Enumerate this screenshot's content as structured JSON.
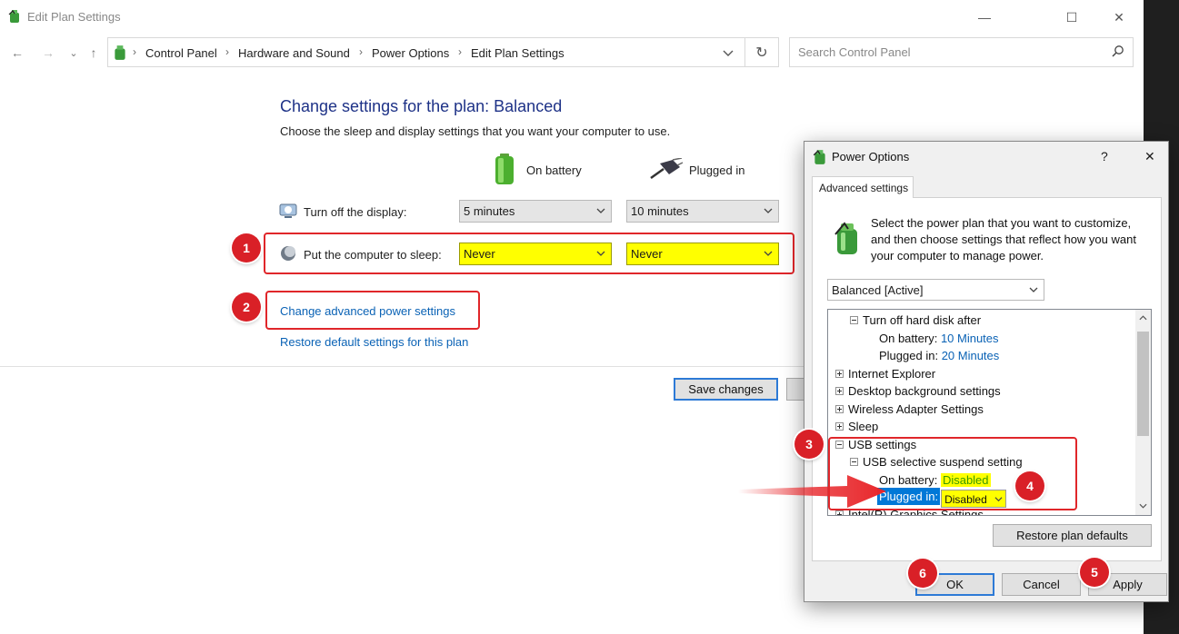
{
  "window": {
    "title": "Edit Plan Settings",
    "controls": {
      "minimize": "—",
      "maximize": "☐",
      "close": "✕"
    }
  },
  "nav": {
    "back": "←",
    "forward": "→",
    "recent": "⌄",
    "up": "↑",
    "breadcrumb": [
      "Control Panel",
      "Hardware and Sound",
      "Power Options",
      "Edit Plan Settings"
    ],
    "refresh": "↻",
    "search_placeholder": "Search Control Panel"
  },
  "plan": {
    "heading": "Change settings for the plan: Balanced",
    "subtitle": "Choose the sleep and display settings that you want your computer to use.",
    "col_battery": "On battery",
    "col_plugged": "Plugged in",
    "rows": [
      {
        "label": "Turn off the display:",
        "battery": "5 minutes",
        "plugged": "10 minutes"
      },
      {
        "label": "Put the computer to sleep:",
        "battery": "Never",
        "plugged": "Never"
      }
    ],
    "advanced_link": "Change advanced power settings",
    "restore_link": "Restore default settings for this plan",
    "save_button": "Save changes"
  },
  "badges": [
    "1",
    "2",
    "3",
    "4",
    "5",
    "6"
  ],
  "dialog": {
    "title": "Power Options",
    "help": "?",
    "close": "✕",
    "tab": "Advanced settings",
    "description": "Select the power plan that you want to customize, and then choose settings that reflect how you want your computer to manage power.",
    "plan_select": "Balanced [Active]",
    "tree": {
      "hard_disk": "Turn off hard disk after",
      "hd_battery_label": "On battery:",
      "hd_battery_value": "10 Minutes",
      "hd_plugged_label": "Plugged in:",
      "hd_plugged_value": "20 Minutes",
      "internet_explorer": "Internet Explorer",
      "desktop_bg": "Desktop background settings",
      "wireless": "Wireless Adapter Settings",
      "sleep": "Sleep",
      "usb": "USB settings",
      "usb_suspend": "USB selective suspend setting",
      "usb_battery_label": "On battery:",
      "usb_battery_value": "Disabled",
      "usb_plugged_label": "Plugged in:",
      "usb_plugged_value": "Disabled",
      "intel_graphics": "Intel(R) Graphics Settings"
    },
    "restore_plan_defaults": "Restore plan defaults",
    "ok": "OK",
    "cancel": "Cancel",
    "apply": "Apply"
  },
  "colors": {
    "highlight": "#ffff00",
    "badge": "#d92027",
    "link": "#0a62b5",
    "heading": "#1e3287",
    "selection": "#0078d7"
  }
}
